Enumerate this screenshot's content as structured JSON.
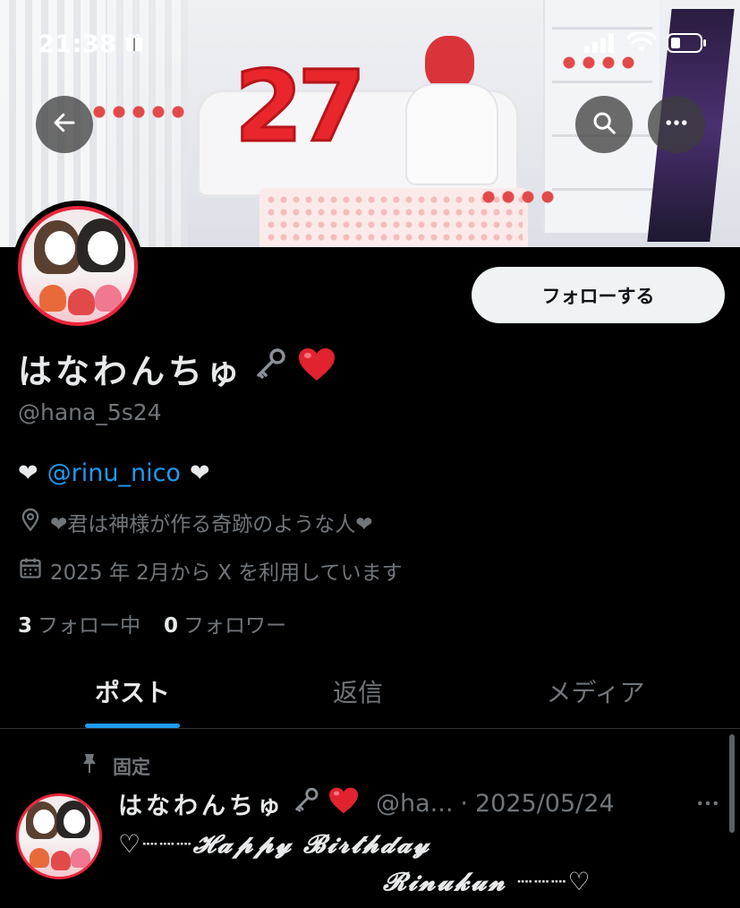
{
  "status_bar": {
    "time": "21:38"
  },
  "banner": {
    "balloon_text": "27"
  },
  "profile": {
    "name": "はなわんちゅ",
    "name_emoji_key": "🗝",
    "name_emoji_heart": "❤️",
    "handle": "@hana_5s24",
    "follow_label": "フォローする",
    "bio": {
      "heart_left": "❤",
      "mention": "@rinu_nico",
      "heart_right": "❤"
    },
    "location": "❤君は神様が作る奇跡のような人❤",
    "joined": "2025 年 2月から X を利用しています",
    "following_count": "3",
    "following_label": "フォロー中",
    "followers_count": "0",
    "followers_label": "フォロワー"
  },
  "tabs": [
    {
      "label": "ポスト",
      "active": true
    },
    {
      "label": "返信",
      "active": false
    },
    {
      "label": "メディア",
      "active": false
    }
  ],
  "pinned_post": {
    "pinned_label": "固定",
    "author_name": "はなわんちゅ",
    "author_emoji_key": "🗝",
    "author_emoji_heart": "❤️",
    "author_handle": "@ha...",
    "date": "2025/05/24",
    "line1": "♡┈┈┈𝓗𝓪𝓹𝓹𝔂 𝓑𝓲𝓻𝓽𝓱𝓭𝓪𝔂",
    "line2": "𝓡𝓲𝓷𝓾𝓴𝓾𝓷 ┈┈┈♡"
  },
  "icons": [
    "back-arrow-icon",
    "search-icon",
    "more-icon",
    "location-icon",
    "calendar-icon",
    "pin-icon",
    "gift-icon",
    "signal-icon",
    "wifi-icon",
    "battery-icon"
  ],
  "colors": {
    "accent": "#1d9bf0",
    "avatar_ring": "#e8263c",
    "background": "#000000"
  }
}
